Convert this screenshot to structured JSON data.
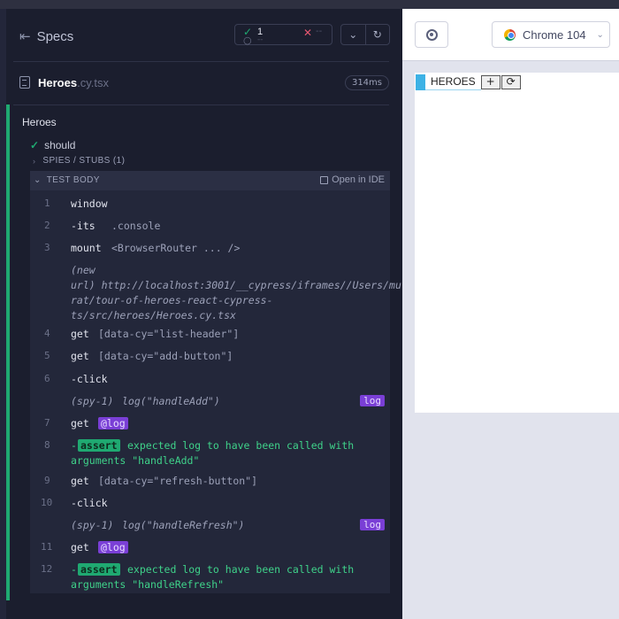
{
  "specs": {
    "title": "Specs"
  },
  "stats": {
    "passed": "1",
    "pending": "--",
    "failed": "--"
  },
  "spec_file": {
    "name": "Heroes",
    "extension": ".cy.tsx",
    "duration": "314ms"
  },
  "suite": {
    "title": "Heroes"
  },
  "test": {
    "title": "should"
  },
  "spies_section": {
    "label": "SPIES / STUBS (1)"
  },
  "test_body": {
    "label": "TEST BODY",
    "open_in_ide": "Open in IDE"
  },
  "commands": [
    {
      "num": "1",
      "name": "window",
      "msg": ""
    },
    {
      "num": "2",
      "name": "-its",
      "msg": ".console"
    },
    {
      "num": "3",
      "name": "mount",
      "msg": "<BrowserRouter ... />"
    },
    {
      "text": "(new url) http://localhost:3001/__cypress/iframes//Users/murat/tour-of-heroes-react-cypress-ts/src/heroes/Heroes.cy.tsx",
      "line1": "(new",
      "line2": "url)  http://localhost:3001/__cypress/iframes//Users/mu",
      "line3": "rat/tour-of-heroes-react-cypress-",
      "line4": "ts/src/heroes/Heroes.cy.tsx"
    },
    {
      "num": "4",
      "name": "get",
      "msg": "[data-cy=\"list-header\"]"
    },
    {
      "num": "5",
      "name": "get",
      "msg": "[data-cy=\"add-button\"]"
    },
    {
      "num": "6",
      "name": "-click",
      "msg": ""
    },
    {
      "spy": "(spy-1)",
      "call": "log(\"handleAdd\")",
      "badge": "log"
    },
    {
      "num": "7",
      "name": "get",
      "alias": "@log"
    },
    {
      "num": "8",
      "dash": "-",
      "assert": "assert",
      "line1": "expected log to have been called with",
      "line2": "arguments \"handleAdd\""
    },
    {
      "num": "9",
      "name": "get",
      "msg": "[data-cy=\"refresh-button\"]"
    },
    {
      "num": "10",
      "name": "-click",
      "msg": ""
    },
    {
      "spy": "(spy-1)",
      "call": "log(\"handleRefresh\")",
      "badge": "log"
    },
    {
      "num": "11",
      "name": "get",
      "alias": "@log"
    },
    {
      "num": "12",
      "dash": "-",
      "assert": "assert",
      "line1": "expected log to have been called with",
      "line2": "arguments \"handleRefresh\""
    }
  ],
  "browser": {
    "name": "Chrome 104"
  },
  "app": {
    "title": "HEROES",
    "add_label": "+",
    "refresh_label": "⟳"
  }
}
